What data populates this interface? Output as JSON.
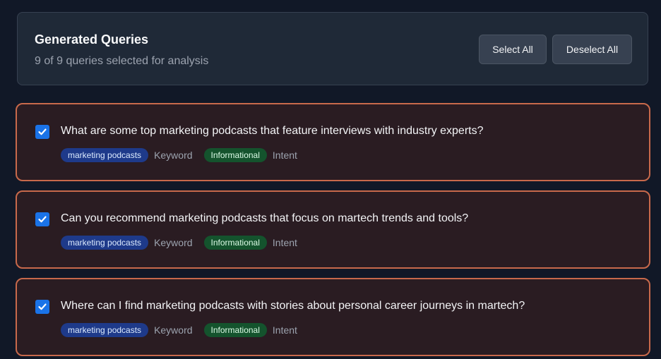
{
  "header": {
    "title": "Generated Queries",
    "subtitle": "9 of 9 queries selected for analysis",
    "select_all_label": "Select All",
    "deselect_all_label": "Deselect All"
  },
  "queries": [
    {
      "text": "What are some top marketing podcasts that feature interviews with industry experts?",
      "keyword": "marketing podcasts",
      "keyword_label": "Keyword",
      "intent": "Informational",
      "intent_label": "Intent",
      "checked": true
    },
    {
      "text": "Can you recommend marketing podcasts that focus on martech trends and tools?",
      "keyword": "marketing podcasts",
      "keyword_label": "Keyword",
      "intent": "Informational",
      "intent_label": "Intent",
      "checked": true
    },
    {
      "text": "Where can I find marketing podcasts with stories about personal career journeys in martech?",
      "keyword": "marketing podcasts",
      "keyword_label": "Keyword",
      "intent": "Informational",
      "intent_label": "Intent",
      "checked": true
    }
  ],
  "colors": {
    "background": "#111827",
    "card_border": "#c8694b",
    "checkbox": "#1a73e8",
    "keyword_badge": "#1e3a8a",
    "intent_badge": "#14532d"
  },
  "icons": {
    "checkbox": "checkmark-icon"
  }
}
